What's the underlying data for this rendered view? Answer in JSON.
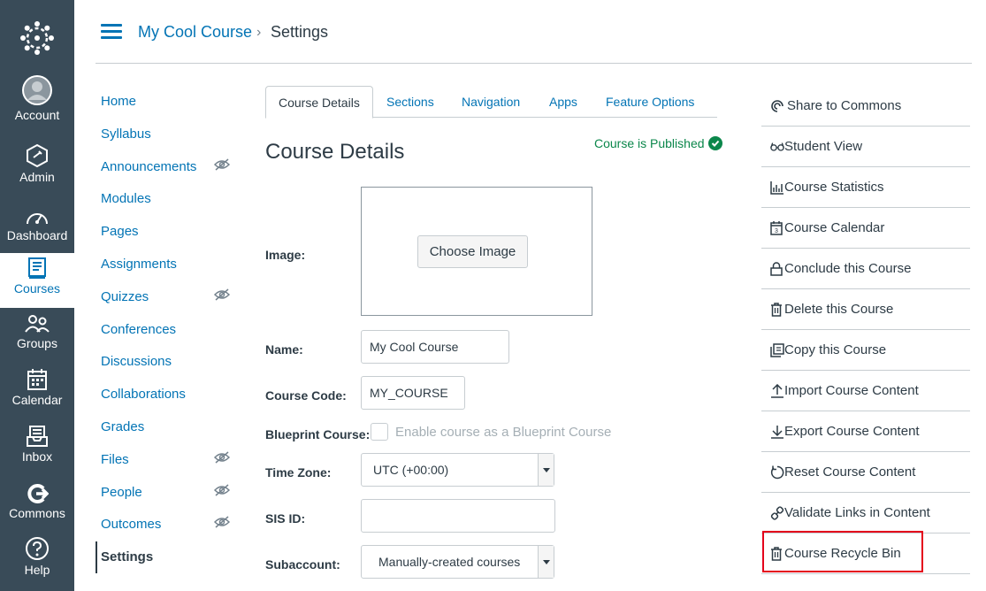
{
  "global_nav": {
    "items": [
      {
        "label": "Account",
        "icon": "avatar-icon"
      },
      {
        "label": "Admin",
        "icon": "admin-icon"
      },
      {
        "label": "Dashboard",
        "icon": "dashboard-icon"
      },
      {
        "label": "Courses",
        "icon": "book-icon",
        "active": true
      },
      {
        "label": "Groups",
        "icon": "groups-icon"
      },
      {
        "label": "Calendar",
        "icon": "calendar-icon"
      },
      {
        "label": "Inbox",
        "icon": "inbox-icon"
      },
      {
        "label": "Commons",
        "icon": "commons-icon"
      },
      {
        "label": "Help",
        "icon": "help-icon"
      }
    ]
  },
  "breadcrumb": {
    "course": "My Cool Course",
    "separator": "›",
    "current": "Settings"
  },
  "course_nav": {
    "items": [
      {
        "label": "Home"
      },
      {
        "label": "Syllabus"
      },
      {
        "label": "Announcements",
        "hidden": true
      },
      {
        "label": "Modules"
      },
      {
        "label": "Pages"
      },
      {
        "label": "Assignments"
      },
      {
        "label": "Quizzes",
        "hidden": true
      },
      {
        "label": "Conferences"
      },
      {
        "label": "Discussions"
      },
      {
        "label": "Collaborations"
      },
      {
        "label": "Grades"
      },
      {
        "label": "Files",
        "hidden": true
      },
      {
        "label": "People",
        "hidden": true
      },
      {
        "label": "Outcomes",
        "hidden": true
      },
      {
        "label": "Settings",
        "active": true
      }
    ]
  },
  "tabs": [
    {
      "label": "Course Details",
      "active": true
    },
    {
      "label": "Sections"
    },
    {
      "label": "Navigation"
    },
    {
      "label": "Apps"
    },
    {
      "label": "Feature Options"
    }
  ],
  "status": {
    "published": "Course is Published"
  },
  "form": {
    "heading": "Course Details",
    "image_label": "Image:",
    "choose_image": "Choose Image",
    "name_label": "Name:",
    "name_value": "My Cool Course",
    "code_label": "Course Code:",
    "code_value": "MY_COURSE",
    "blueprint_label": "Blueprint Course:",
    "blueprint_checkbox": "Enable course as a Blueprint Course",
    "timezone_label": "Time Zone:",
    "timezone_value": "UTC (+00:00)",
    "sis_label": "SIS ID:",
    "sis_value": "",
    "subaccount_label": "Subaccount:",
    "subaccount_value": "Manually-created courses"
  },
  "sidebar": {
    "items": [
      {
        "label": "Share to Commons",
        "icon": "share-icon"
      },
      {
        "label": "Student View",
        "icon": "glasses-icon"
      },
      {
        "label": "Course Statistics",
        "icon": "stats-icon"
      },
      {
        "label": "Course Calendar",
        "icon": "calendar-icon"
      },
      {
        "label": "Conclude this Course",
        "icon": "lock-icon"
      },
      {
        "label": "Delete this Course",
        "icon": "trash-icon"
      },
      {
        "label": "Copy this Course",
        "icon": "copy-icon"
      },
      {
        "label": "Import Course Content",
        "icon": "upload-icon"
      },
      {
        "label": "Export Course Content",
        "icon": "download-icon"
      },
      {
        "label": "Reset Course Content",
        "icon": "reset-icon"
      },
      {
        "label": "Validate Links in Content",
        "icon": "link-icon"
      },
      {
        "label": "Course Recycle Bin",
        "icon": "trash-icon",
        "highlighted": true
      }
    ]
  },
  "colors": {
    "nav_bg": "#394b58",
    "link": "#0374b5",
    "published": "#0b874b",
    "highlight": "#e4001b"
  }
}
